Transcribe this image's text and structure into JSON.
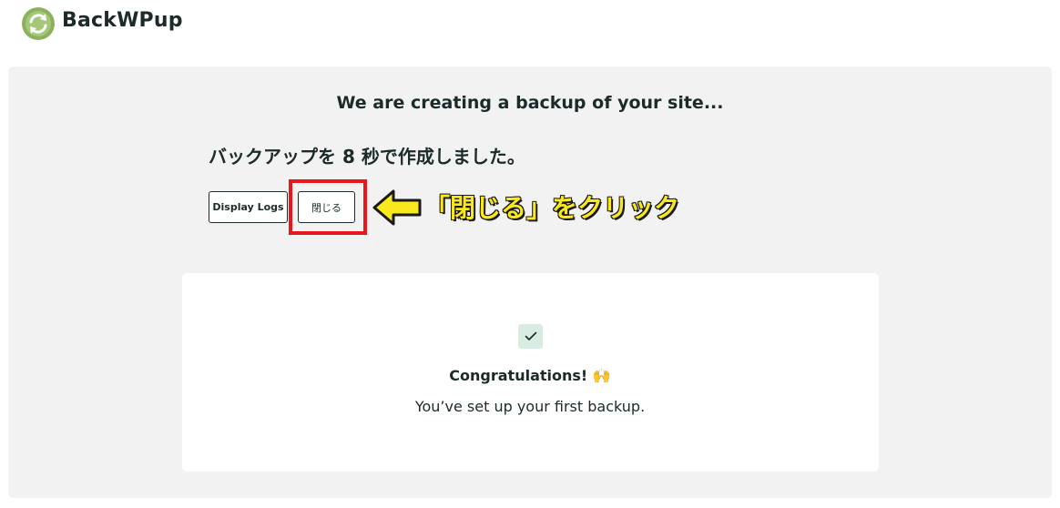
{
  "header": {
    "logo_text": "BackWPup",
    "logo_icon": "backwpup-refresh-icon"
  },
  "backup": {
    "title": "We are creating a backup of your site...",
    "status": "バックアップを 8 秒で作成しました。",
    "display_logs_label": "Display Logs",
    "close_label": "閉じる"
  },
  "annotation": {
    "text": "「閉じる」をクリック",
    "color": "#f8e81c",
    "box_color": "#e8171c"
  },
  "card": {
    "icon": "check-icon",
    "congrats_title": "Congratulations! 🙌",
    "congrats_sub": "You’ve set up your first backup."
  },
  "colors": {
    "brand_green": "#8bb25a",
    "panel_bg": "#f2f2f2",
    "check_bg": "#d8ece2",
    "text": "#1c2a2a"
  }
}
